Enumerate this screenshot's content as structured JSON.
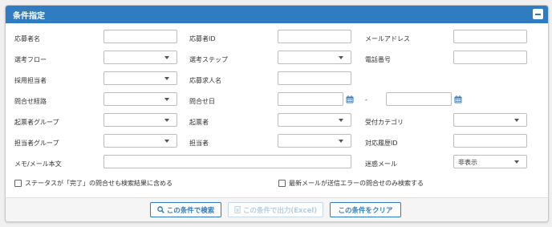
{
  "panel": {
    "title": "条件指定"
  },
  "fields": {
    "applicant_name": {
      "label": "応募者名",
      "value": ""
    },
    "applicant_id": {
      "label": "応募者ID",
      "value": ""
    },
    "email": {
      "label": "メールアドレス",
      "value": ""
    },
    "selection_flow": {
      "label": "選考フロー",
      "value": ""
    },
    "selection_step": {
      "label": "選考ステップ",
      "value": ""
    },
    "phone": {
      "label": "電話番号",
      "value": ""
    },
    "recruiter": {
      "label": "採用担当者",
      "value": ""
    },
    "job_name": {
      "label": "応募求人名",
      "value": ""
    },
    "inquiry_route": {
      "label": "問合せ経路",
      "value": ""
    },
    "inquiry_date": {
      "label": "問合せ日",
      "from": "",
      "to": "",
      "separator": "-"
    },
    "creator_group": {
      "label": "起票者グループ",
      "value": ""
    },
    "creator": {
      "label": "起票者",
      "value": ""
    },
    "reception_category": {
      "label": "受付カテゴリ",
      "value": ""
    },
    "assignee_group": {
      "label": "担当者グループ",
      "value": ""
    },
    "assignee": {
      "label": "担当者",
      "value": ""
    },
    "history_id": {
      "label": "対応履歴ID",
      "value": ""
    },
    "memo_body": {
      "label": "メモ/メール本文",
      "value": ""
    },
    "spam": {
      "label": "迷惑メール",
      "value": "非表示"
    }
  },
  "checkboxes": {
    "include_completed": {
      "label": "ステータスが「完了」の問合せも検索結果に含める",
      "checked": false
    },
    "latest_error_only": {
      "label": "最新メールが送信エラーの問合せのみ検索する",
      "checked": false
    }
  },
  "buttons": {
    "search": "この条件で検索",
    "export": "この条件で出力(Excel)",
    "clear": "この条件をクリア"
  },
  "colors": {
    "accent": "#2f7dc0",
    "header_text": "#ffffff"
  },
  "icons": {
    "collapse": "minus-icon",
    "calendar": "calendar-icon",
    "search": "search-icon",
    "excel": "excel-icon"
  }
}
